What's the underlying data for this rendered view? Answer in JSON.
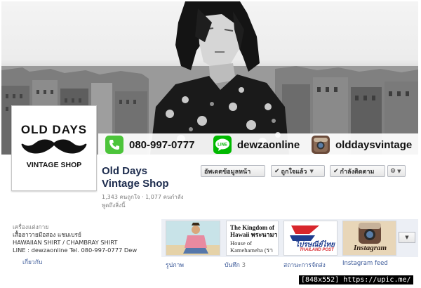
{
  "contact_band": {
    "phone": "080-997-0777",
    "line_id": "dewzaonline",
    "instagram_id": "olddaysvintage",
    "line_badge": "LINE"
  },
  "profile": {
    "logo_line1": "OLD DAYS",
    "logo_line2": "VINTAGE SHOP"
  },
  "page": {
    "name_line1": "Old Days",
    "name_line2": "Vintage Shop",
    "stats": "1,343 คนถูกใจ · 1,077 คนกำลัง",
    "talking": "พูดถึงสิ่งนี้"
  },
  "buttons": {
    "update_info": "อัพเดตข้อมูลหน้า",
    "liked": "ถูกใจแล้ว",
    "following": "กำลังติดตาม"
  },
  "about": {
    "category": "เครื่องแต่งกาย",
    "line1": "เสื้อฮาวายมือสอง แชมเบรย์",
    "line2": "HAWAIIAN SHIRT / CHAMBRAY SHIRT",
    "line3": "LINE : dewzaonline Tel. 080-997-0777 Dew",
    "more_link": "เกี่ยวกับ"
  },
  "tiles": [
    {
      "label": "รูปภาพ",
      "count": ""
    },
    {
      "label": "บันทึก",
      "count": "3",
      "title_line1": "The Kingdom of",
      "title_line2": "Hawaii พระนามา",
      "sub_line1": "House of",
      "sub_line2": "Kamehameha (รา"
    },
    {
      "label": "สถานะการจัดส่ง",
      "count": "",
      "logo_text": "ไปรษณีย์ไทย",
      "logo_sub": "THAILAND POST"
    },
    {
      "label": "Instagram feed",
      "count": "",
      "logo_text": "Instagram"
    }
  ],
  "watermark": "[848x552] https://upic.me/",
  "colors": {
    "fb_link": "#3b5998",
    "name": "#1c2b4d",
    "line_green": "#00b900",
    "phone_green": "#4cc43a"
  },
  "icons": [
    "phone-icon",
    "line-icon",
    "instagram-icon",
    "mustache-icon",
    "check-icon",
    "gear-icon",
    "chevron-down-icon"
  ]
}
